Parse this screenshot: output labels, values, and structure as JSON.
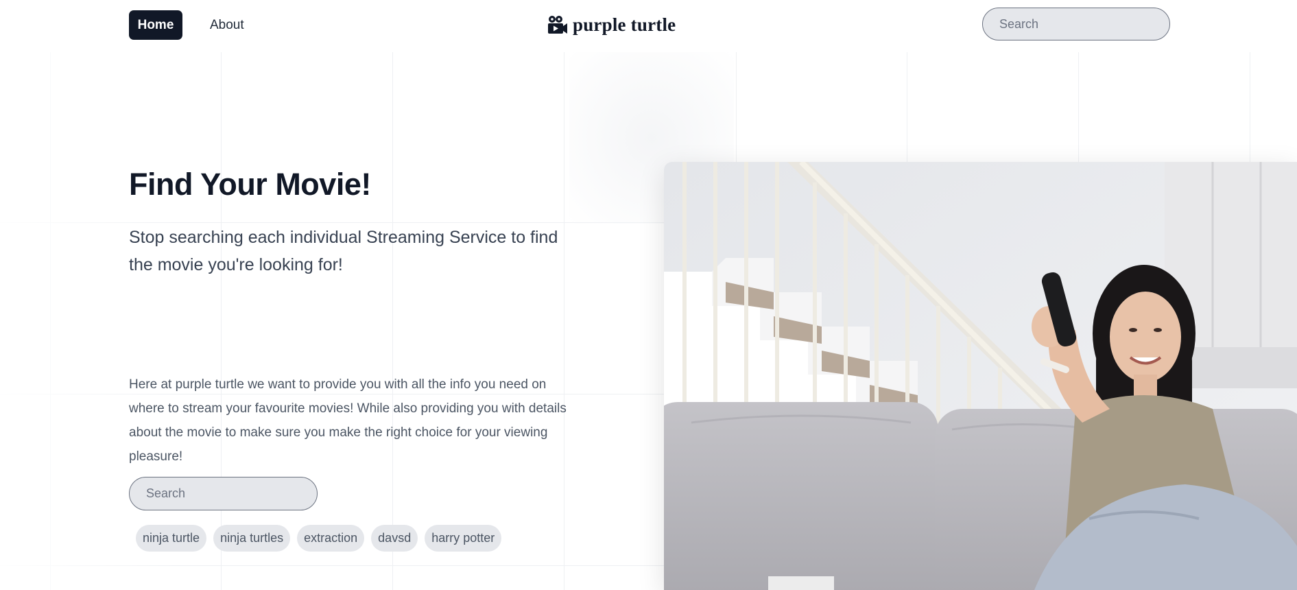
{
  "nav": {
    "home_label": "Home",
    "about_label": "About"
  },
  "brand": {
    "name": "purple turtle",
    "icon": "movie-camera-icon"
  },
  "header_search": {
    "placeholder": "Search"
  },
  "hero": {
    "title": "Find Your Movie!",
    "subtitle": "Stop searching each individual Streaming Service to find the movie you're looking for!",
    "body": "Here at purple turtle we want to provide you with all the info you need on where to stream your favourite movies! While also providing you with details about the movie to make sure you make the right choice for your viewing pleasure!",
    "search_placeholder": "Search",
    "recent_searches": [
      "ninja turtle",
      "ninja turtles",
      "extraction",
      "davsd",
      "harry potter"
    ]
  },
  "colors": {
    "primary_dark": "#111827",
    "input_bg": "#e5e7eb",
    "tag_bg": "#e5e7eb",
    "text_muted": "#4b5563"
  }
}
